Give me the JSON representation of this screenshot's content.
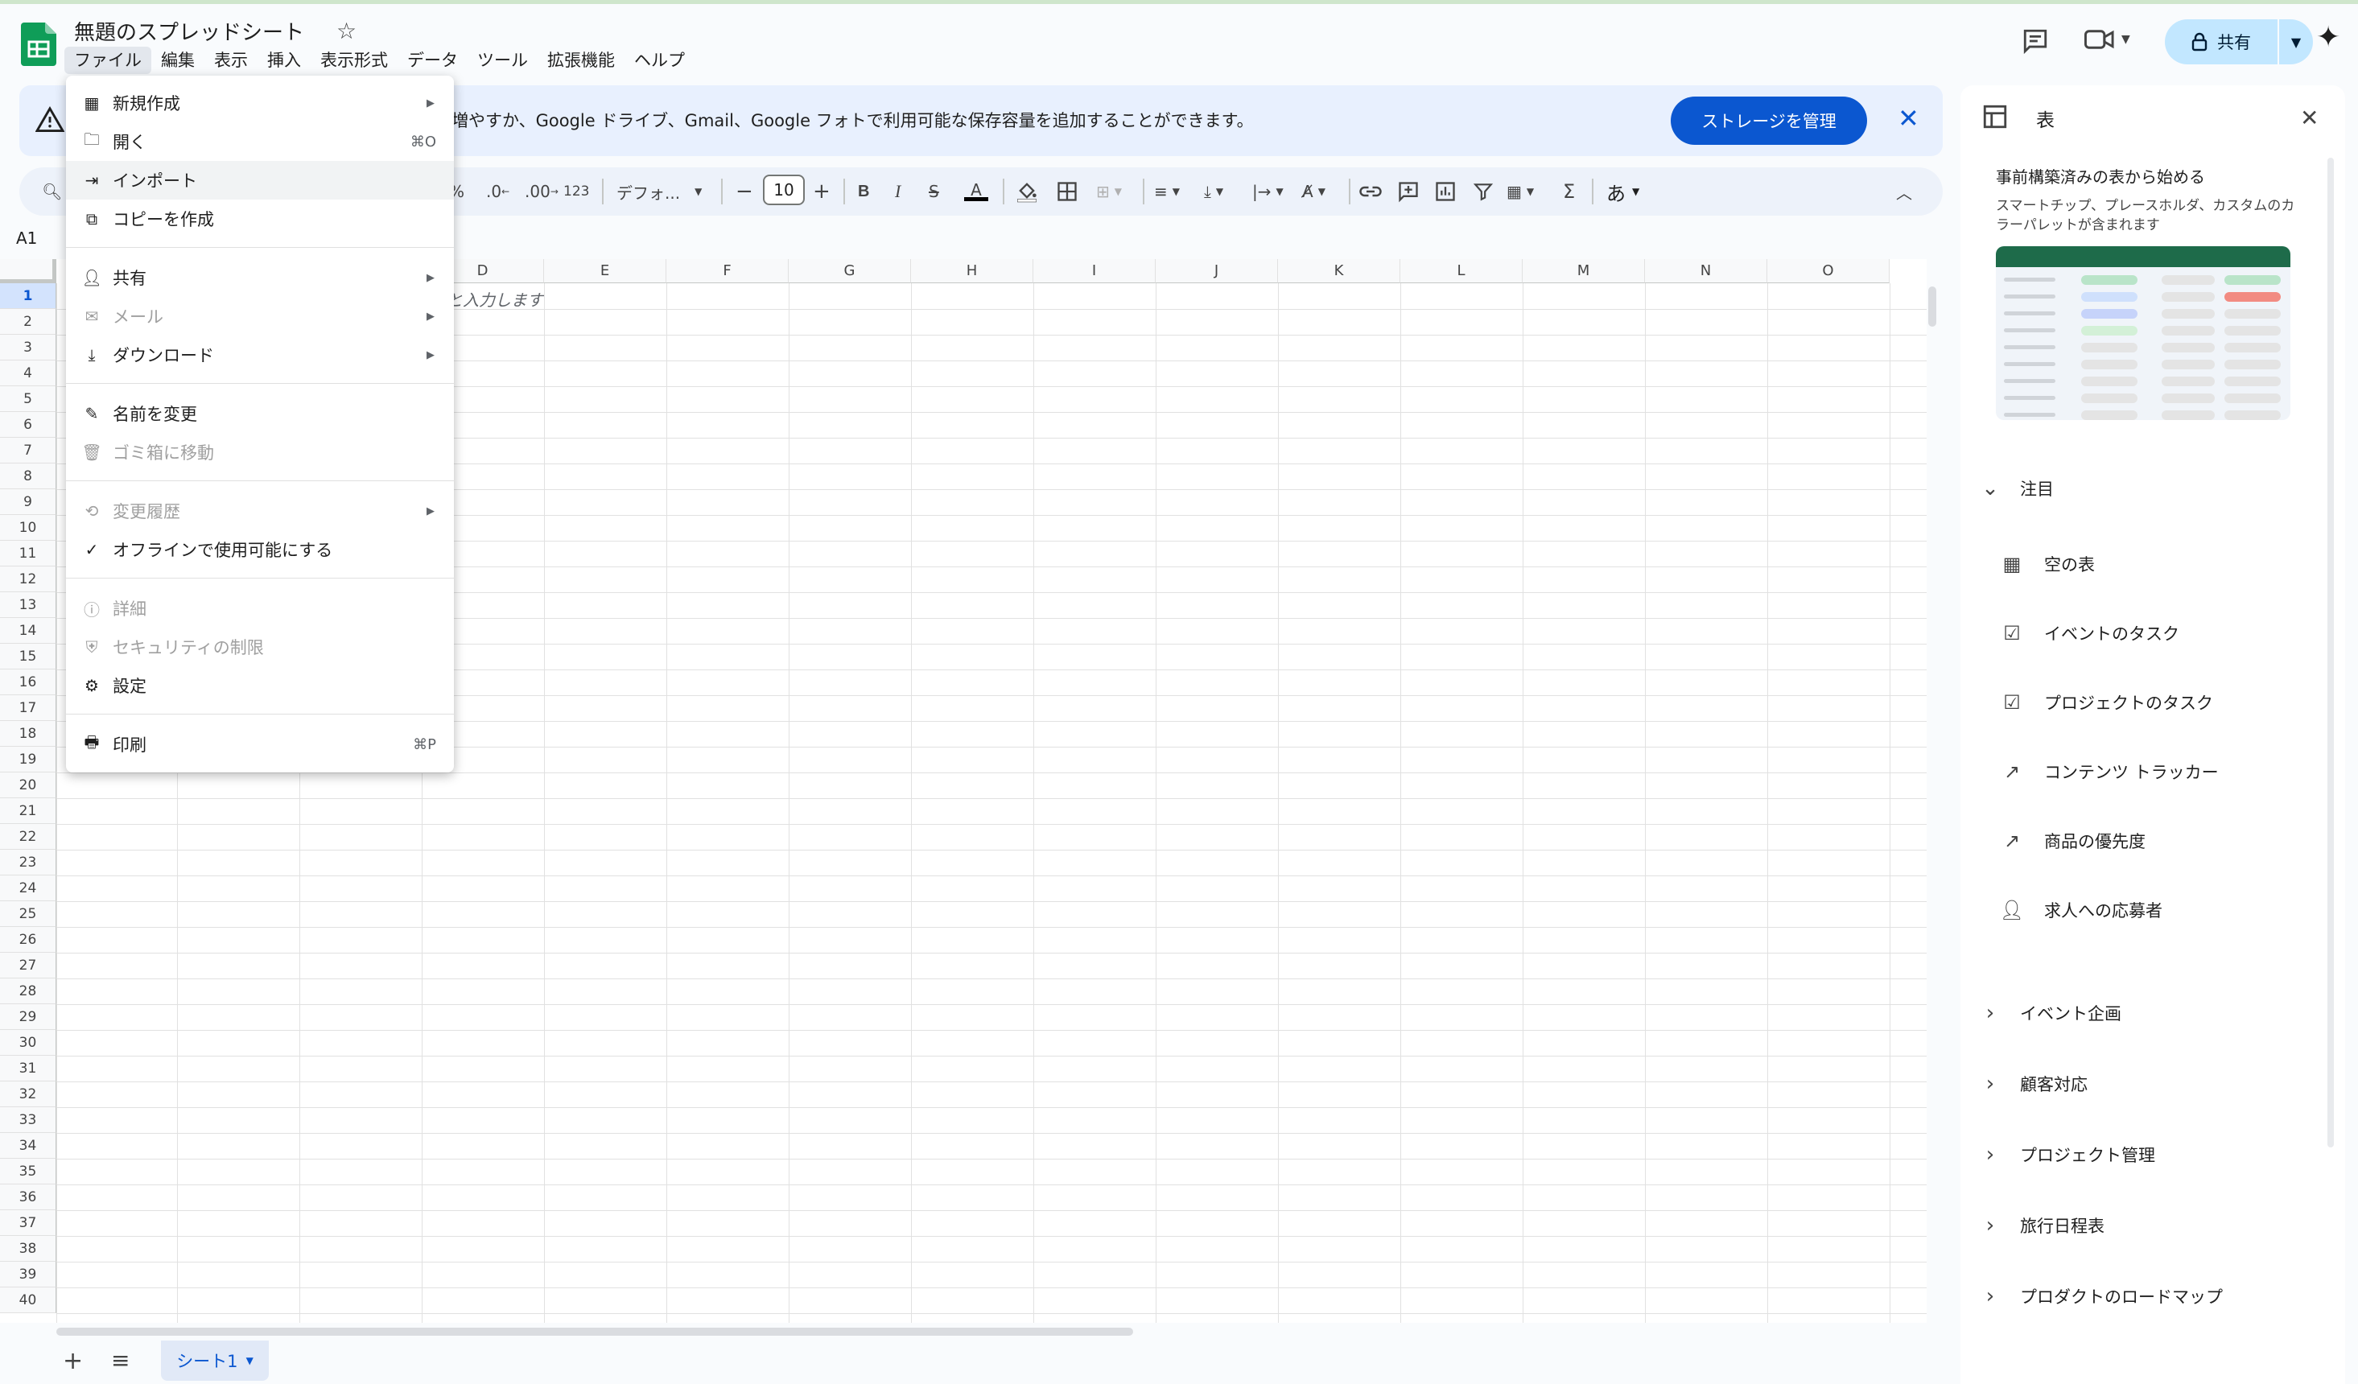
{
  "app": {
    "title": "無題のスプレッドシート"
  },
  "menu": [
    "ファイル",
    "編集",
    "表示",
    "挿入",
    "表示形式",
    "データ",
    "ツール",
    "拡張機能",
    "ヘルプ"
  ],
  "header": {
    "share_label": "共有"
  },
  "banner": {
    "text": "を増やすか、Google ドライブ、Gmail、Google フォトで利用可能な保存容量を追加することができます。",
    "button": "ストレージを管理"
  },
  "toolbar": {
    "percent": "%",
    "dec_decrease": ".0",
    "dec_increase": ".00",
    "number_format": "123",
    "font": "デフォ...",
    "font_size": "10",
    "input_tools": "あ"
  },
  "namebox": "A1",
  "columns": [
    "D",
    "E",
    "F",
    "G",
    "H",
    "I",
    "J",
    "K",
    "L",
    "M",
    "N",
    "O"
  ],
  "rows": [
    "1",
    "2",
    "3",
    "4",
    "5",
    "6",
    "7",
    "8",
    "9",
    "10",
    "11",
    "12",
    "13",
    "14",
    "15",
    "16",
    "17",
    "18",
    "19",
    "20",
    "21",
    "22",
    "23",
    "24",
    "25",
    "26",
    "27",
    "28",
    "29",
    "30",
    "31",
    "32",
    "33",
    "34",
    "35",
    "36",
    "37",
    "38",
    "39",
    "40"
  ],
  "cell_hint": "と入力します",
  "file_menu": {
    "items": [
      {
        "label": "新規作成",
        "shortcut": "",
        "submenu": true
      },
      {
        "label": "開く",
        "shortcut": "⌘O",
        "submenu": false
      },
      {
        "label": "インポート",
        "shortcut": "",
        "submenu": false
      },
      {
        "label": "コピーを作成",
        "shortcut": "",
        "submenu": false
      },
      {
        "label": "共有",
        "shortcut": "",
        "submenu": true
      },
      {
        "label": "メール",
        "shortcut": "",
        "submenu": true
      },
      {
        "label": "ダウンロード",
        "shortcut": "",
        "submenu": true
      },
      {
        "label": "名前を変更",
        "shortcut": "",
        "submenu": false
      },
      {
        "label": "ゴミ箱に移動",
        "shortcut": "",
        "submenu": false
      },
      {
        "label": "変更履歴",
        "shortcut": "",
        "submenu": true
      },
      {
        "label": "オフラインで使用可能にする",
        "shortcut": "",
        "submenu": false
      },
      {
        "label": "詳細",
        "shortcut": "",
        "submenu": false
      },
      {
        "label": "セキュリティの制限",
        "shortcut": "",
        "submenu": false
      },
      {
        "label": "設定",
        "shortcut": "",
        "submenu": false
      },
      {
        "label": "印刷",
        "shortcut": "⌘P",
        "submenu": false
      }
    ]
  },
  "panel": {
    "title": "表",
    "subtitle": "事前構築済みの表から始める",
    "description": "スマートチップ、プレースホルダ、カスタムのカラーパレットが含まれます",
    "featured_label": "注目",
    "templates": [
      "空の表",
      "イベントのタスク",
      "プロジェクトのタスク",
      "コンテンツ トラッカー",
      "商品の優先度",
      "求人への応募者"
    ],
    "sections": [
      "イベント企画",
      "顧客対応",
      "プロジェクト管理",
      "旅行日程表",
      "プロダクトのロードマップ"
    ]
  },
  "sheet_tab": {
    "label": "シート1"
  },
  "colors": {
    "accent": "#0b57d0",
    "banner_bg": "#e8f0fe",
    "share_bg": "#c2e7ff",
    "sheets_green": "#0f9d58"
  }
}
